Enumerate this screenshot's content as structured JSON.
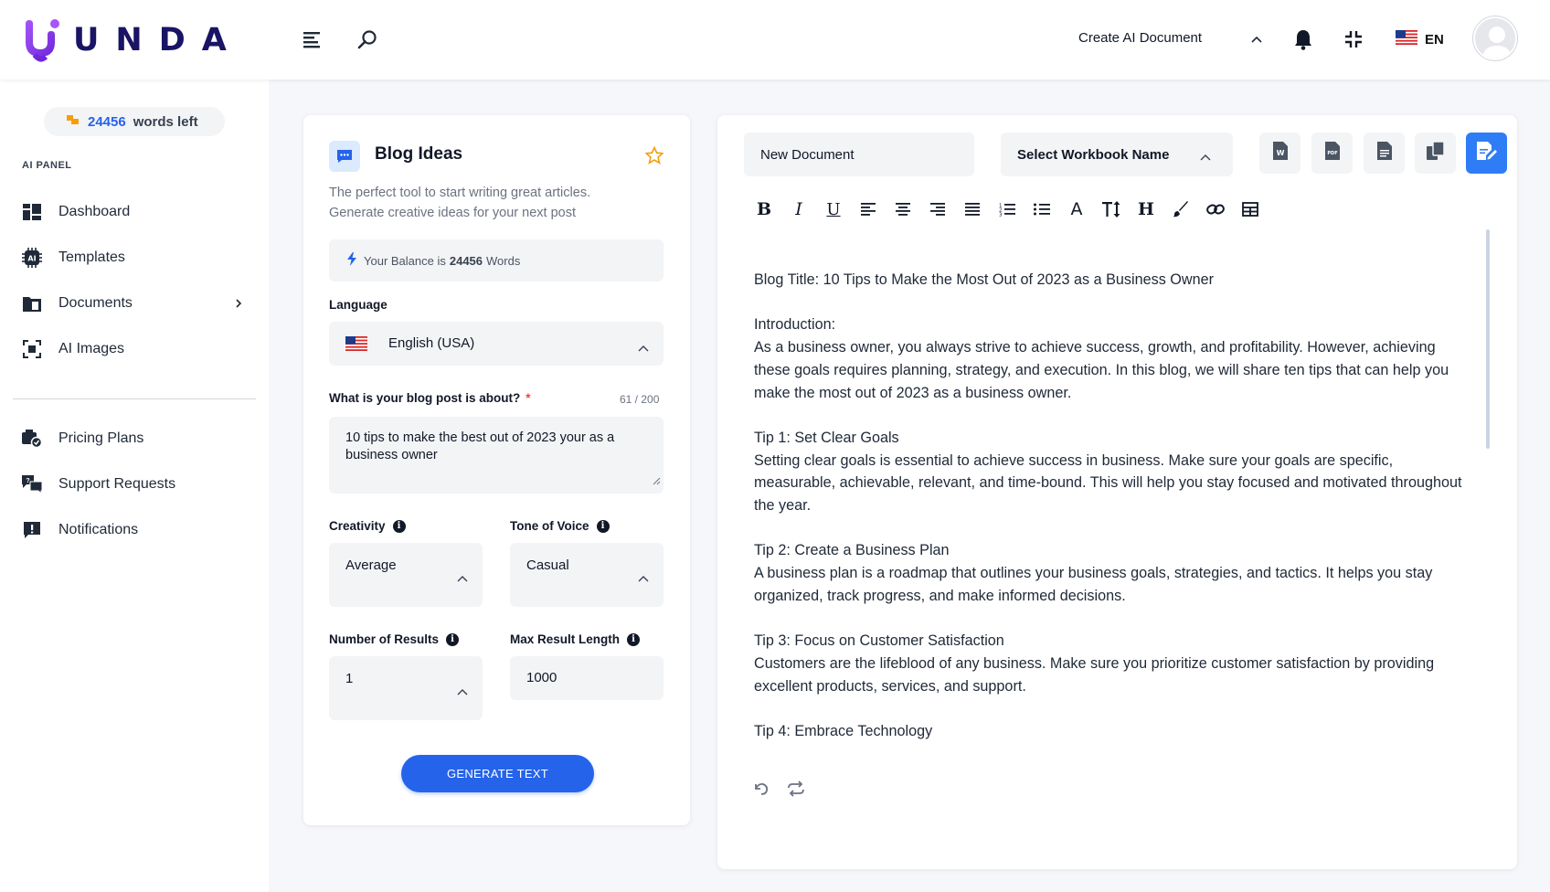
{
  "header": {
    "logo_text": "UNDA",
    "create_label": "Create AI Document",
    "lang_code": "EN",
    "icons": [
      "menu-icon",
      "search-icon",
      "chevron-up-icon",
      "bell-icon",
      "compress-icon",
      "flag-us-icon",
      "avatar"
    ]
  },
  "sidebar": {
    "words_count": "24456",
    "words_label": "words left",
    "panel_label": "AI PANEL",
    "items": [
      {
        "label": "Dashboard",
        "icon": "dashboard-icon"
      },
      {
        "label": "Templates",
        "icon": "ai-chip-icon"
      },
      {
        "label": "Documents",
        "icon": "folder-icon"
      },
      {
        "label": "AI Images",
        "icon": "image-scan-icon"
      },
      {
        "label": "Pricing Plans",
        "icon": "pricing-icon"
      },
      {
        "label": "Support Requests",
        "icon": "support-icon"
      },
      {
        "label": "Notifications",
        "icon": "notification-icon"
      }
    ]
  },
  "tool": {
    "title": "Blog Ideas",
    "description": "The perfect tool to start writing great articles. Generate creative ideas for your next post",
    "balance_prefix": "Your Balance is",
    "balance_value": "24456",
    "balance_suffix": "Words",
    "language_label": "Language",
    "language_value": "English (USA)",
    "topic_label": "What is your blog post is about?",
    "topic_required": "*",
    "topic_counter": "61 / 200",
    "topic_value": "10 tips to make the best out of 2023 your as a business owner",
    "creativity_label": "Creativity",
    "creativity_value": "Average",
    "tone_label": "Tone of Voice",
    "tone_value": "Casual",
    "results_label": "Number of Results",
    "results_value": "1",
    "maxlen_label": "Max Result Length",
    "maxlen_value": "1000",
    "generate_label": "GENERATE TEXT"
  },
  "editor": {
    "doc_name": "New Document",
    "workbook_label": "Select Workbook Name",
    "export_buttons": [
      "word-export-icon",
      "pdf-export-icon",
      "text-export-icon",
      "copy-icon",
      "save-icon"
    ],
    "toolbar": [
      "bold-icon",
      "italic-icon",
      "underline-icon",
      "align-left-icon",
      "align-center-icon",
      "align-right-icon",
      "align-justify-icon",
      "ordered-list-icon",
      "bullet-list-icon",
      "font-color-icon",
      "font-size-icon",
      "heading-icon",
      "brush-icon",
      "link-icon",
      "table-icon"
    ],
    "content": [
      "Blog Title: 10 Tips to Make the Most Out of 2023 as a Business Owner",
      "",
      "Introduction:",
      "As a business owner, you always strive to achieve success, growth, and profitability. However, achieving these goals requires planning, strategy, and execution. In this blog, we will share ten tips that can help you make the most out of 2023 as a business owner.",
      "",
      "Tip 1: Set Clear Goals",
      "Setting clear goals is essential to achieve success in business. Make sure your goals are specific, measurable, achievable, relevant, and time-bound. This will help you stay focused and motivated throughout the year.",
      "",
      "Tip 2: Create a Business Plan",
      "A business plan is a roadmap that outlines your business goals, strategies, and tactics. It helps you stay organized, track progress, and make informed decisions.",
      "",
      "Tip 3: Focus on Customer Satisfaction",
      "Customers are the lifeblood of any business. Make sure you prioritize customer satisfaction by providing excellent products, services, and support.",
      "",
      "Tip 4: Embrace Technology"
    ]
  },
  "colors": {
    "accent": "#2563eb",
    "brand_dark": "#1a1464",
    "brand_purple": "#7c3aed",
    "background": "#f5f7fb",
    "field_bg": "#f3f4f6",
    "required": "#ef4444",
    "star": "#f59e0b"
  }
}
